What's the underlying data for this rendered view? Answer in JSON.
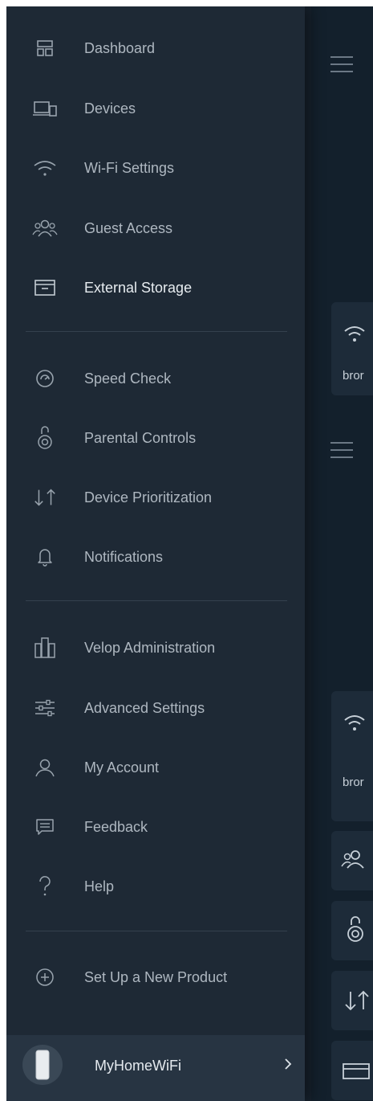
{
  "menu": {
    "dashboard": "Dashboard",
    "devices": "Devices",
    "wifi_settings": "Wi-Fi Settings",
    "guest_access": "Guest Access",
    "external_storage": "External Storage",
    "speed_check": "Speed Check",
    "parental_controls": "Parental Controls",
    "device_prioritization": "Device Prioritization",
    "notifications": "Notifications",
    "velop_administration": "Velop Administration",
    "advanced_settings": "Advanced Settings",
    "my_account": "My Account",
    "feedback": "Feedback",
    "help": "Help",
    "set_up_new_product": "Set Up a New Product"
  },
  "footer": {
    "network_name": "MyHomeWiFi"
  },
  "background": {
    "card1_text": "bror",
    "card2_text": "bror"
  },
  "colors": {
    "drawer_bg": "#1e2935",
    "text": "#aeb7c0",
    "active_text": "#e7ecf0",
    "icon": "#98a3ad"
  },
  "active_item": "External Storage"
}
